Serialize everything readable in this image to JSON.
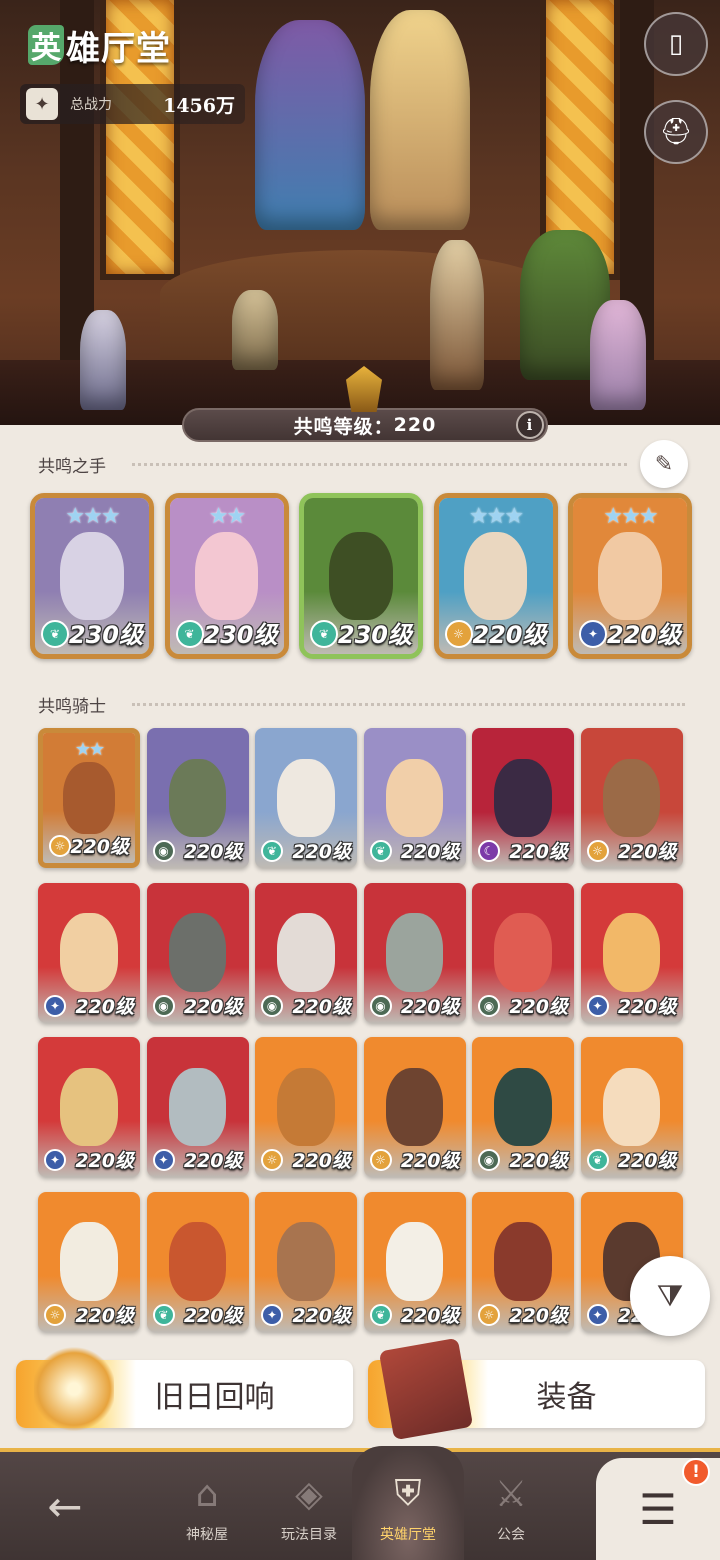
{
  "header": {
    "title_first_char": "英",
    "title_rest": "雄厅堂",
    "power_label": "总战力",
    "power_value": "1456万"
  },
  "resonance": {
    "label": "共鸣等级：",
    "value": "220",
    "info_label": "i"
  },
  "sections": {
    "hands_title": "共鸣之手",
    "knights_title": "共鸣骑士"
  },
  "hands": [
    {
      "level": "230级",
      "stars": "★★★",
      "class_icon": "leaf-icon",
      "bg": "#8f7fb2",
      "face": "#d8d2e4",
      "frame": "gold"
    },
    {
      "level": "230级",
      "stars": "★★",
      "class_icon": "leaf-icon",
      "bg": "#b98fc6",
      "face": "#f3c7d2",
      "frame": "gold"
    },
    {
      "level": "230级",
      "stars": "",
      "class_icon": "leaf-icon",
      "bg": "#5b8a3a",
      "face": "#3e4f24",
      "frame": "green"
    },
    {
      "level": "220级",
      "stars": "★★★",
      "class_icon": "sun-icon",
      "bg": "#4fa0c4",
      "face": "#ead7c0",
      "frame": "gold"
    },
    {
      "level": "220级",
      "stars": "★★★",
      "class_icon": "star-icon",
      "bg": "#e1883a",
      "face": "#f1c9a3",
      "frame": "gold"
    }
  ],
  "knights": [
    {
      "level": "220级",
      "stars": "★★",
      "class_icon": "sun-icon",
      "bg": "#d27c36",
      "face": "#a75a2e",
      "frame": "gold"
    },
    {
      "level": "220级",
      "stars": "",
      "class_icon": "eye-icon",
      "bg": "#7a6faf",
      "face": "#6b7a58",
      "frame": "plain"
    },
    {
      "level": "220级",
      "stars": "",
      "class_icon": "leaf-icon",
      "bg": "#8aa6cf",
      "face": "#eee8e0",
      "frame": "plain"
    },
    {
      "level": "220级",
      "stars": "",
      "class_icon": "leaf-icon",
      "bg": "#9a8fc6",
      "face": "#f1cfa9",
      "frame": "plain"
    },
    {
      "level": "220级",
      "stars": "",
      "class_icon": "moon-icon",
      "bg": "#b8243a",
      "face": "#3b2a44",
      "frame": "plain"
    },
    {
      "level": "220级",
      "stars": "",
      "class_icon": "sun-icon",
      "bg": "#c8473a",
      "face": "#9b6a47",
      "frame": "plain"
    },
    {
      "level": "220级",
      "stars": "",
      "class_icon": "star-icon",
      "bg": "#d43a3a",
      "face": "#f1cfa2",
      "frame": "plain"
    },
    {
      "level": "220级",
      "stars": "",
      "class_icon": "eye-icon",
      "bg": "#c8333a",
      "face": "#6c6f6a",
      "frame": "plain"
    },
    {
      "level": "220级",
      "stars": "",
      "class_icon": "eye-icon",
      "bg": "#c8333a",
      "face": "#e3dbd6",
      "frame": "plain"
    },
    {
      "level": "220级",
      "stars": "",
      "class_icon": "eye-icon",
      "bg": "#c8333a",
      "face": "#9ba49d",
      "frame": "plain"
    },
    {
      "level": "220级",
      "stars": "",
      "class_icon": "eye-icon",
      "bg": "#c8333a",
      "face": "#e05c52",
      "frame": "plain"
    },
    {
      "level": "220级",
      "stars": "",
      "class_icon": "star-icon",
      "bg": "#d43a3a",
      "face": "#f2b868",
      "frame": "plain"
    },
    {
      "level": "220级",
      "stars": "",
      "class_icon": "star-icon",
      "bg": "#d43a3a",
      "face": "#e6c27f",
      "frame": "plain"
    },
    {
      "level": "220级",
      "stars": "",
      "class_icon": "star-icon",
      "bg": "#c8333a",
      "face": "#b2bcc0",
      "frame": "plain"
    },
    {
      "level": "220级",
      "stars": "",
      "class_icon": "sun-icon",
      "bg": "#f08a2e",
      "face": "#c57a36",
      "frame": "plain"
    },
    {
      "level": "220级",
      "stars": "",
      "class_icon": "sun-icon",
      "bg": "#f08a2e",
      "face": "#6e4430",
      "frame": "plain"
    },
    {
      "level": "220级",
      "stars": "",
      "class_icon": "eye-icon",
      "bg": "#f08a2e",
      "face": "#2f4a44",
      "frame": "plain"
    },
    {
      "level": "220级",
      "stars": "",
      "class_icon": "leaf-icon",
      "bg": "#f08a2e",
      "face": "#f5dcbd",
      "frame": "plain"
    },
    {
      "level": "220级",
      "stars": "",
      "class_icon": "sun-icon",
      "bg": "#f08a2e",
      "face": "#f2ece0",
      "frame": "plain"
    },
    {
      "level": "220级",
      "stars": "",
      "class_icon": "leaf-icon",
      "bg": "#f08a2e",
      "face": "#c9572f",
      "frame": "plain"
    },
    {
      "level": "220级",
      "stars": "",
      "class_icon": "star-icon",
      "bg": "#f08a2e",
      "face": "#a8744f",
      "frame": "plain"
    },
    {
      "level": "220级",
      "stars": "",
      "class_icon": "leaf-icon",
      "bg": "#f08a2e",
      "face": "#f3efe6",
      "frame": "plain"
    },
    {
      "level": "220级",
      "stars": "",
      "class_icon": "sun-icon",
      "bg": "#f08a2e",
      "face": "#8a3a2c",
      "frame": "plain"
    },
    {
      "level": "220级",
      "stars": "",
      "class_icon": "star-icon",
      "bg": "#f08a2e",
      "face": "#5a3a2e",
      "frame": "plain"
    }
  ],
  "class_colors": {
    "leaf-icon": "#3fb59a",
    "sun-icon": "#e3a23c",
    "star-icon": "#3d5ea8",
    "eye-icon": "#4d6a55",
    "moon-icon": "#7c3aa8"
  },
  "buttons": {
    "echoes": "旧日回响",
    "equipment": "装备"
  },
  "tabs": [
    {
      "label": "神秘屋",
      "icon": "house-icon"
    },
    {
      "label": "玩法目录",
      "icon": "diamond-grid-icon"
    },
    {
      "label": "英雄厅堂",
      "icon": "knight-helmet-icon",
      "active": true
    },
    {
      "label": "公会",
      "icon": "crossed-swords-icon"
    }
  ],
  "menu_badge": "!"
}
